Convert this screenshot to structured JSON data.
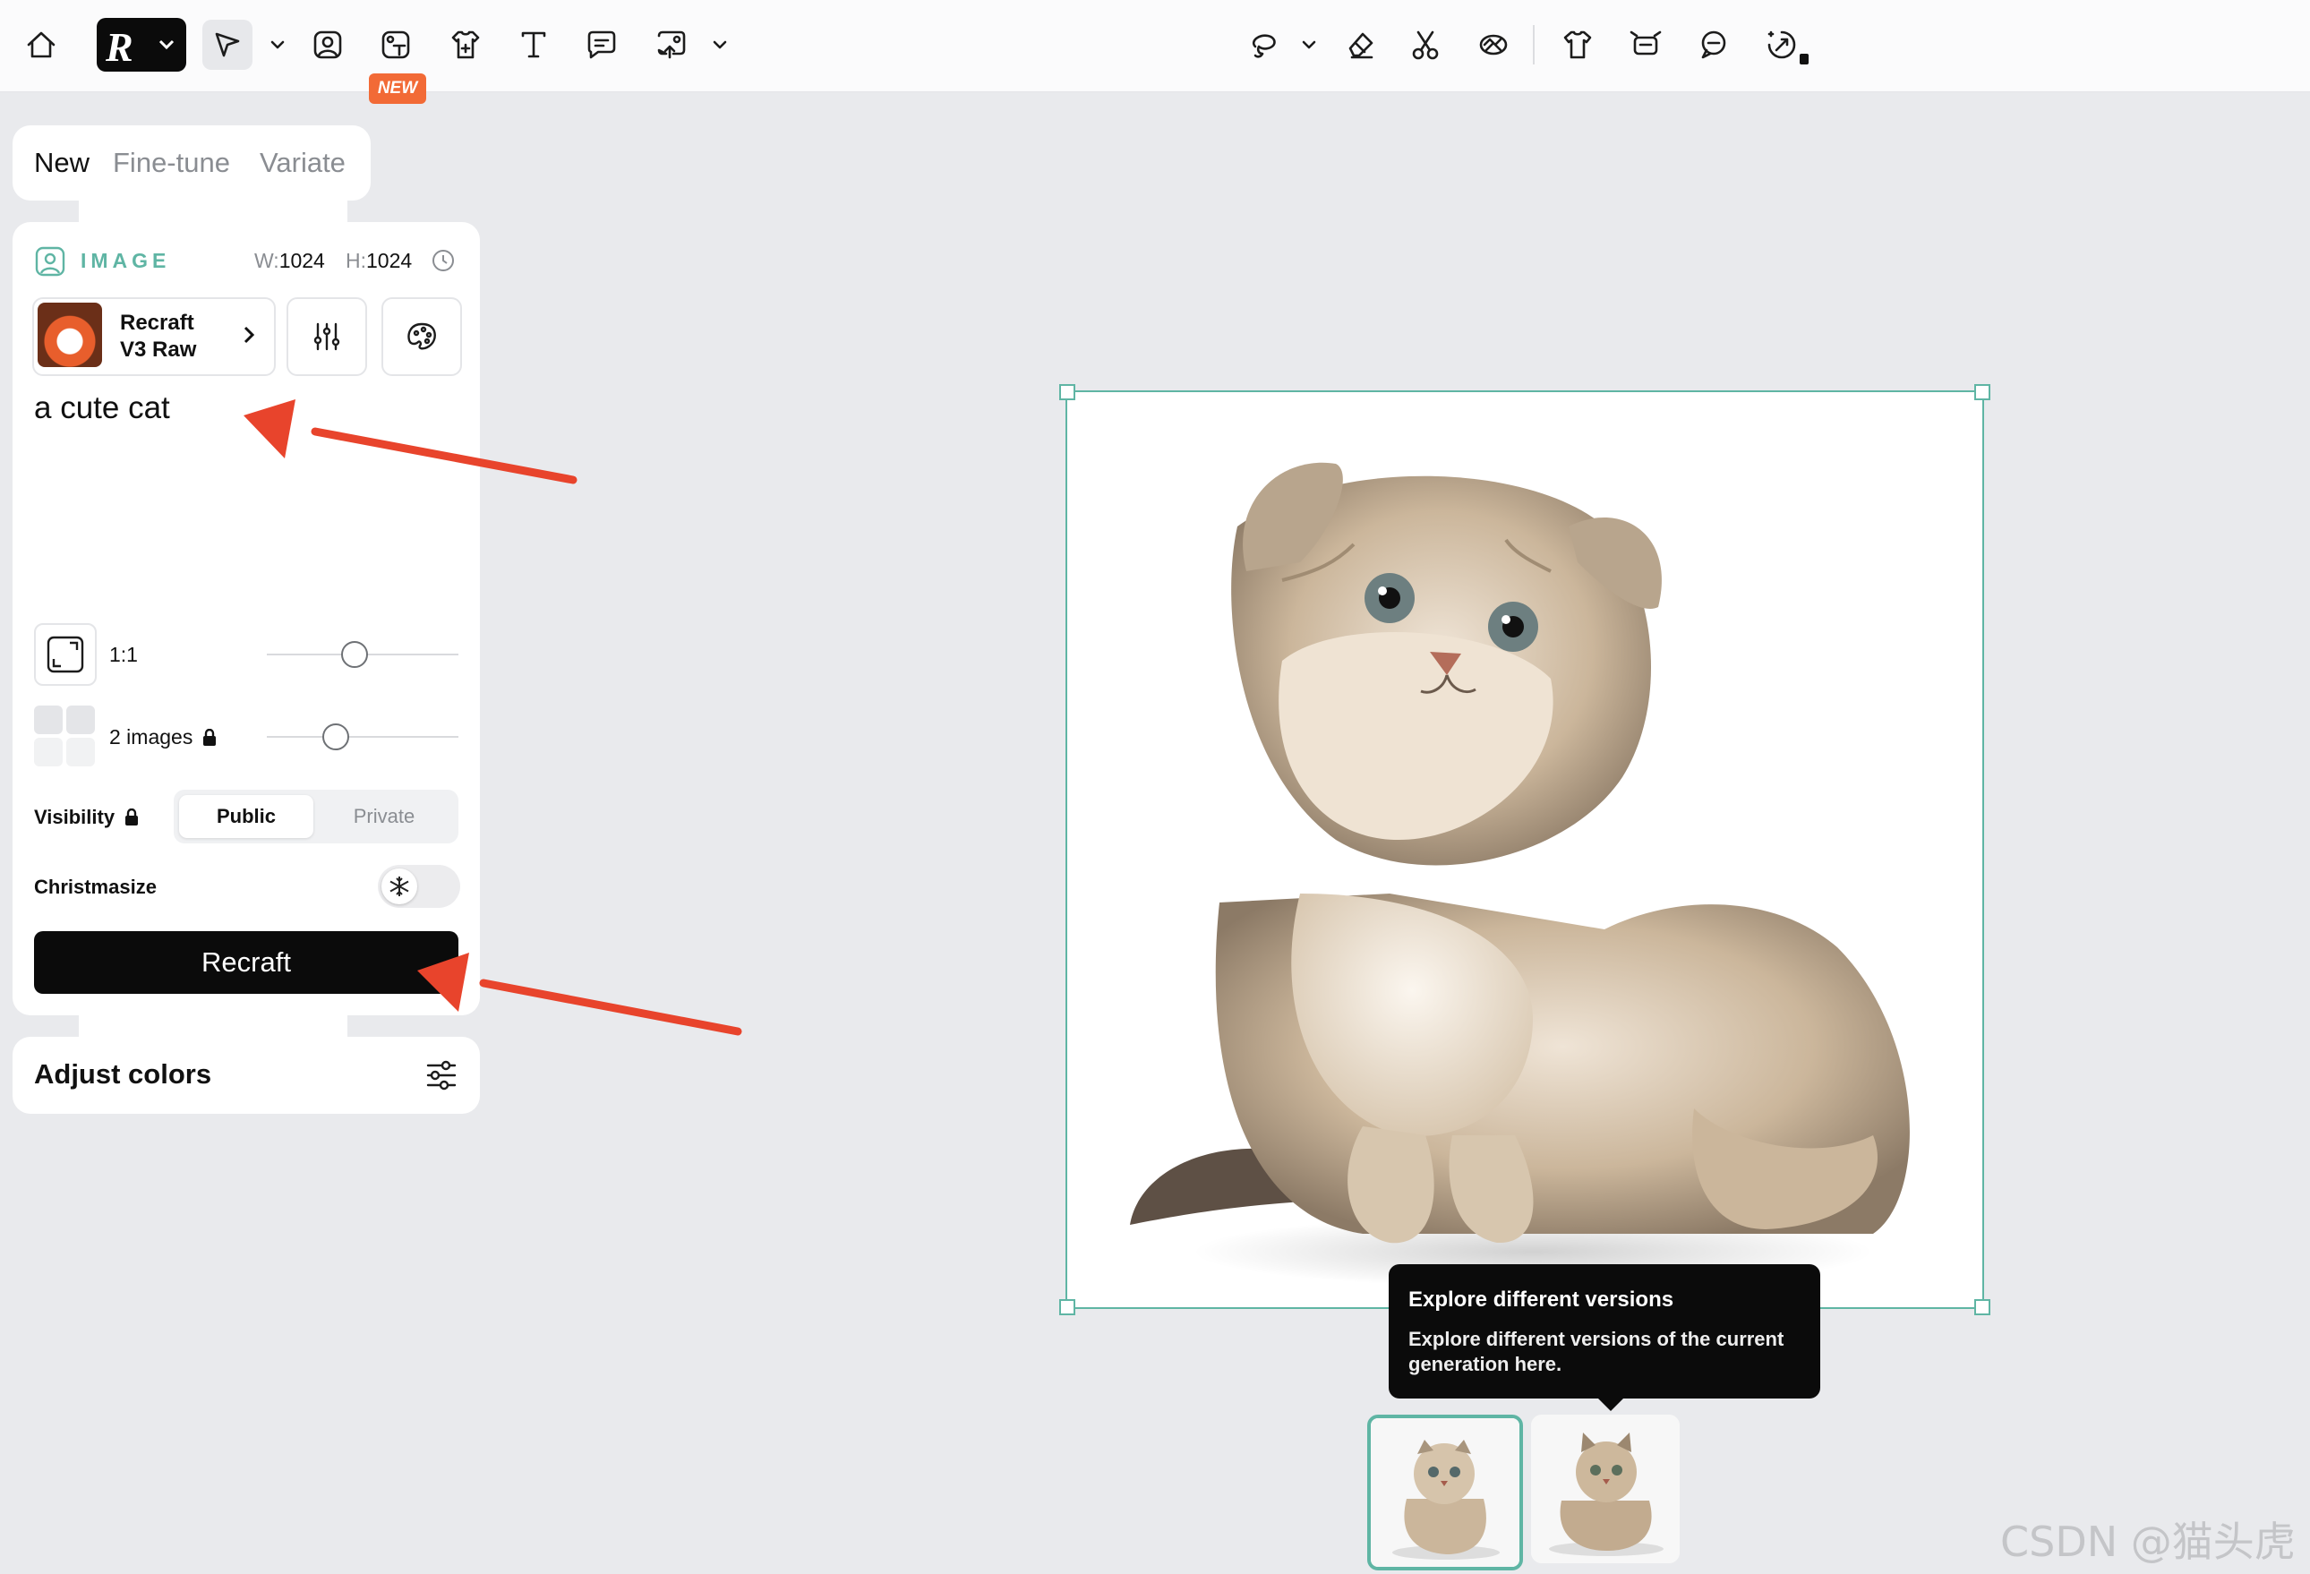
{
  "toolbar": {
    "left_tools": [
      "home-icon",
      "logo-menu",
      "select-tool",
      "image-tool",
      "image-text-tool",
      "mockup-tool",
      "text-tool",
      "comment-tool",
      "upload-tool"
    ],
    "new_badge": "NEW",
    "right_tools": [
      "lasso-tool",
      "eraser-tool",
      "scissors-tool",
      "vectorize-tool",
      "shirt-tool",
      "expand-tool",
      "remove-background-tool",
      "upscale-tool"
    ]
  },
  "mode_tabs": [
    "New",
    "Fine-tune",
    "Variate"
  ],
  "panel": {
    "section_title": "IMAGE",
    "width_label": "W:",
    "width_value": "1024",
    "height_label": "H:",
    "height_value": "1024",
    "model_line1": "Recraft",
    "model_line2": "V3 Raw",
    "prompt": "a cute cat",
    "aspect_ratio": "1:1",
    "aspect_slider_level": 0.45,
    "images_count": "2 images",
    "images_slider_level": 0.35,
    "visibility_label": "Visibility",
    "visibility_options": [
      "Public",
      "Private"
    ],
    "visibility_selected": "Public",
    "christmasize_label": "Christmasize",
    "christmasize_on": false,
    "recraft_button": "Recraft"
  },
  "adjust_colors": {
    "label": "Adjust colors"
  },
  "tooltip": {
    "title": "Explore different versions",
    "body": "Explore different versions of the current generation here."
  },
  "variants": {
    "count": 2,
    "selected_index": 0
  },
  "colors": {
    "accent": "#5fb5a4",
    "badge": "#f26a36",
    "arrow": "#e8442c",
    "button": "#0b0b0b"
  },
  "watermark": "CSDN @猫头虎"
}
